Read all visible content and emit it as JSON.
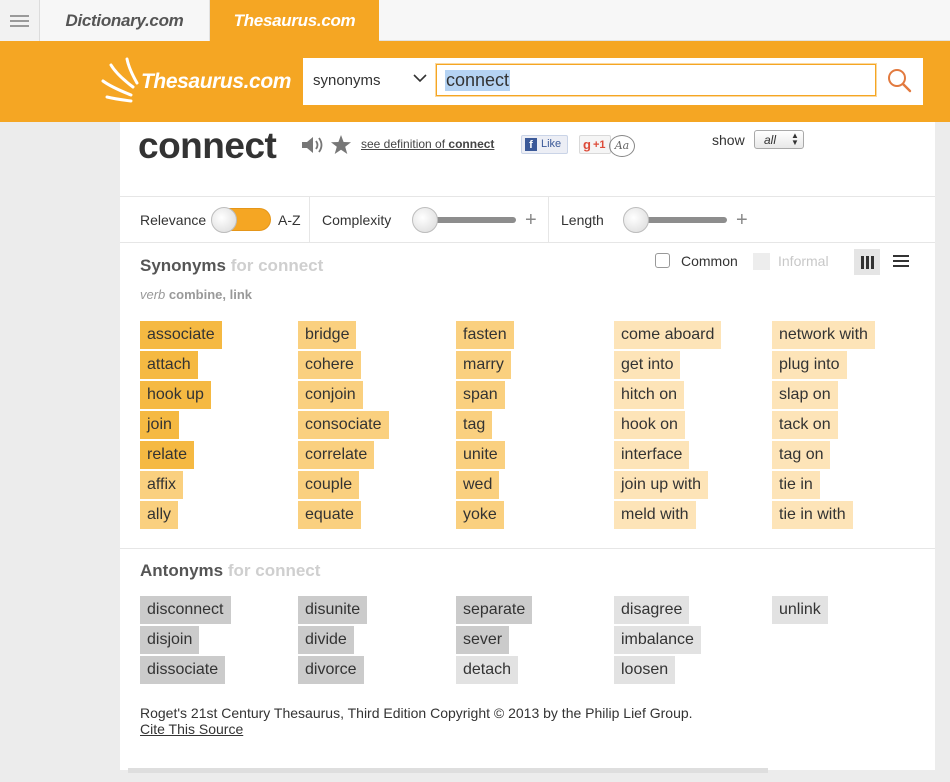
{
  "tabs": {
    "dictionary": "Dictionary.com",
    "thesaurus": "Thesaurus.com"
  },
  "header": {
    "logo_text": "Thesaurus.com",
    "search_type": "synonyms",
    "search_value": "connect",
    "accent_color": "#f5a623"
  },
  "entry": {
    "word": "connect",
    "see_definition_prefix": "see definition of ",
    "see_definition_word": "connect",
    "fb_label": "Like",
    "gplus_label": "+1",
    "font_toggle": "Aa",
    "show_label": "show",
    "show_value": "all"
  },
  "filters": {
    "relevance": "Relevance",
    "az": "A-Z",
    "complexity": "Complexity",
    "length": "Length"
  },
  "synonyms": {
    "title": "Synonyms",
    "for_text": "for connect",
    "pos": "verb",
    "sense": "combine, link",
    "common_label": "Common",
    "informal_label": "Informal",
    "columns": [
      [
        "associate",
        "attach",
        "hook up",
        "join",
        "relate",
        "affix",
        "ally"
      ],
      [
        "bridge",
        "cohere",
        "conjoin",
        "consociate",
        "correlate",
        "couple",
        "equate"
      ],
      [
        "fasten",
        "marry",
        "span",
        "tag",
        "unite",
        "wed",
        "yoke"
      ],
      [
        "come aboard",
        "get into",
        "hitch on",
        "hook on",
        "interface",
        "join up with",
        "meld with"
      ],
      [
        "network with",
        "plug into",
        "slap on",
        "tack on",
        "tag on",
        "tie in",
        "tie in with"
      ]
    ]
  },
  "antonyms": {
    "title": "Antonyms",
    "for_text": "for connect",
    "columns": [
      [
        "disconnect",
        "disjoin",
        "dissociate"
      ],
      [
        "disunite",
        "divide",
        "divorce"
      ],
      [
        "separate",
        "sever",
        "detach"
      ],
      [
        "disagree",
        "imbalance",
        "loosen"
      ],
      [
        "unlink"
      ]
    ]
  },
  "footer": {
    "copyright": "Roget's 21st Century Thesaurus, Third Edition Copyright © 2013 by the Philip Lief Group.",
    "cite": "Cite This Source"
  }
}
